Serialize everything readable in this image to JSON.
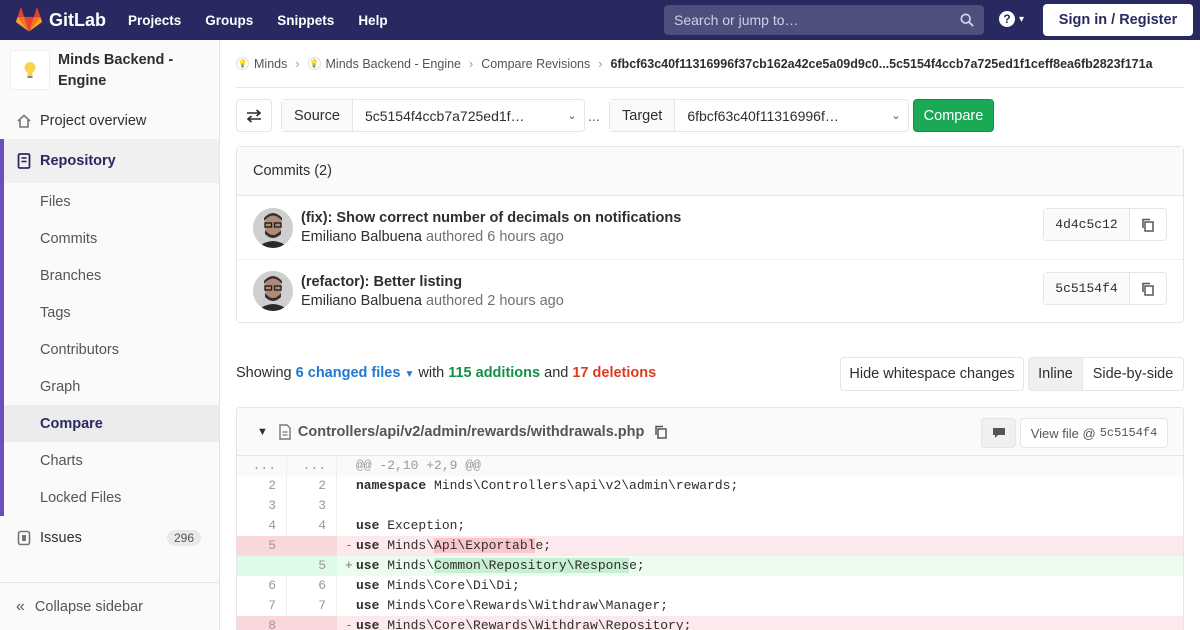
{
  "navbar": {
    "brand": "GitLab",
    "links": [
      "Projects",
      "Groups",
      "Snippets",
      "Help"
    ],
    "search_placeholder": "Search or jump to…",
    "help_glyph": "?",
    "signin": "Sign in / Register"
  },
  "sidebar": {
    "project_name": "Minds Backend - Engine",
    "overview": "Project overview",
    "repository": "Repository",
    "repo_items": [
      "Files",
      "Commits",
      "Branches",
      "Tags",
      "Contributors",
      "Graph",
      "Compare",
      "Charts",
      "Locked Files"
    ],
    "active_item": "Compare",
    "issues": "Issues",
    "issues_count": "296",
    "collapse": "Collapse sidebar"
  },
  "breadcrumb": {
    "items": [
      "Minds",
      "Minds Backend - Engine",
      "Compare Revisions"
    ],
    "current": "6fbcf63c40f11316996f37cb162a42ce5a09d9c0...5c5154f4ccb7a725ed1f1ceff8ea6fb2823f171a"
  },
  "compare": {
    "source_label": "Source",
    "source_value": "5c5154f4ccb7a725ed1f…",
    "dots": "...",
    "target_label": "Target",
    "target_value": "6fbcf63c40f11316996f…",
    "button": "Compare"
  },
  "commits": {
    "header": "Commits (2)",
    "items": [
      {
        "title": "(fix): Show correct number of decimals on notifications",
        "author": "Emiliano Balbuena",
        "authored": "authored 6 hours ago",
        "sha": "4d4c5c12"
      },
      {
        "title": "(refactor): Better listing",
        "author": "Emiliano Balbuena",
        "authored": "authored 2 hours ago",
        "sha": "5c5154f4"
      }
    ]
  },
  "stats": {
    "showing": "Showing",
    "changed_files": "6 changed files",
    "with": "with",
    "additions": "115 additions",
    "and": "and",
    "deletions": "17 deletions",
    "hide_whitespace": "Hide whitespace changes",
    "inline": "Inline",
    "side_by_side": "Side-by-side"
  },
  "diff": {
    "file_path": "Controllers/api/v2/admin/rewards/withdrawals.php",
    "view_file": "View file @",
    "view_sha": "5c5154f4",
    "lines": [
      {
        "type": "meta",
        "old": "...",
        "new": "...",
        "sign": "",
        "kw": "",
        "pre": "@@ -2,10 +2,9 @@",
        "hl": "",
        "post": ""
      },
      {
        "type": "ctx",
        "old": "2",
        "new": "2",
        "sign": "",
        "kw": "namespace",
        "pre": " Minds\\Controllers\\api\\v2\\admin\\rewards;",
        "hl": "",
        "post": ""
      },
      {
        "type": "ctx",
        "old": "3",
        "new": "3",
        "sign": "",
        "kw": "",
        "pre": "",
        "hl": "",
        "post": ""
      },
      {
        "type": "ctx",
        "old": "4",
        "new": "4",
        "sign": "",
        "kw": "use",
        "pre": " Exception;",
        "hl": "",
        "post": ""
      },
      {
        "type": "old",
        "old": "5",
        "new": "",
        "sign": "-",
        "kw": "use",
        "pre": " Minds\\",
        "hl": "Api\\Exportabl",
        "post": "e;"
      },
      {
        "type": "new",
        "old": "",
        "new": "5",
        "sign": "+",
        "kw": "use",
        "pre": " Minds\\",
        "hl": "Common\\Repository\\Respons",
        "post": "e;"
      },
      {
        "type": "ctx",
        "old": "6",
        "new": "6",
        "sign": "",
        "kw": "use",
        "pre": " Minds\\Core\\Di\\Di;",
        "hl": "",
        "post": ""
      },
      {
        "type": "ctx",
        "old": "7",
        "new": "7",
        "sign": "",
        "kw": "use",
        "pre": " Minds\\Core\\Rewards\\Withdraw\\Manager;",
        "hl": "",
        "post": ""
      },
      {
        "type": "old",
        "old": "8",
        "new": "",
        "sign": "-",
        "kw": "use",
        "pre": " Minds\\Core\\Rewards\\Withdraw\\Repository;",
        "hl": "",
        "post": ""
      }
    ]
  },
  "colors": {
    "navbar": "#292961",
    "compare_button": "#1aaa55",
    "additions": "#168f48",
    "deletions": "#db3b21",
    "link": "#1f78d1"
  },
  "icons": [
    "gitlab-logo-icon",
    "search-icon",
    "help-icon",
    "lightbulb-icon",
    "home-icon",
    "repository-icon",
    "issues-icon",
    "collapse-icon",
    "swap-icon",
    "chevron-down-icon",
    "copy-icon",
    "file-icon",
    "comment-icon"
  ]
}
